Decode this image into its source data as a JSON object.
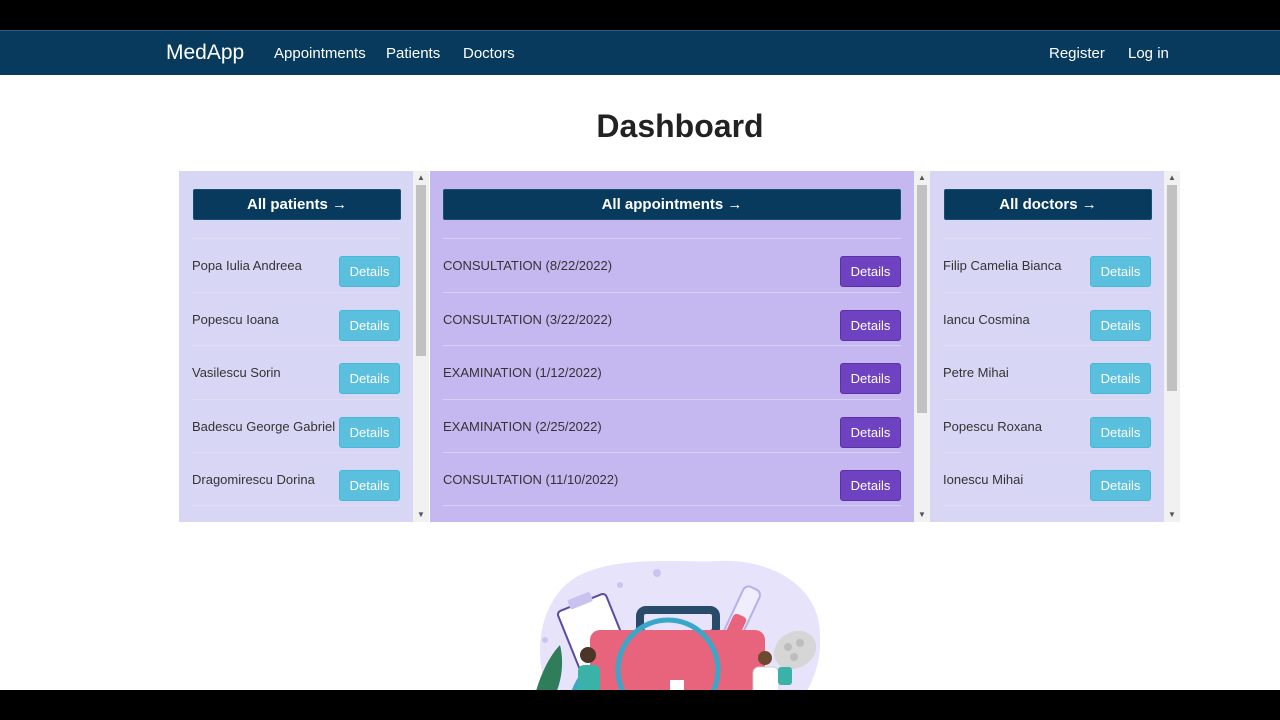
{
  "nav": {
    "brand": "MedApp",
    "links": [
      "Appointments",
      "Patients",
      "Doctors"
    ],
    "right_links": [
      "Register",
      "Log in"
    ]
  },
  "page": {
    "title": "Dashboard"
  },
  "panels": {
    "patients": {
      "header": "All patients →",
      "color": "#d8d6f5",
      "button_color": "#5bc0de",
      "items": [
        {
          "label": "Popa Iulia Andreea",
          "button": "Details"
        },
        {
          "label": "Popescu Ioana",
          "button": "Details"
        },
        {
          "label": "Vasilescu Sorin",
          "button": "Details"
        },
        {
          "label": "Badescu George Gabriel",
          "button": "Details"
        },
        {
          "label": "Dragomirescu Dorina",
          "button": "Details"
        }
      ]
    },
    "appointments": {
      "header": "All appointments →",
      "color": "#c5b8f1",
      "button_color": "#6f42c1",
      "items": [
        {
          "label": "CONSULTATION (8/22/2022)",
          "button": "Details"
        },
        {
          "label": "CONSULTATION (3/22/2022)",
          "button": "Details"
        },
        {
          "label": "EXAMINATION (1/12/2022)",
          "button": "Details"
        },
        {
          "label": "EXAMINATION (2/25/2022)",
          "button": "Details"
        },
        {
          "label": "CONSULTATION (11/10/2022)",
          "button": "Details"
        }
      ]
    },
    "doctors": {
      "header": "All doctors →",
      "color": "#d8d6f5",
      "button_color": "#5bc0de",
      "items": [
        {
          "label": "Filip Camelia Bianca",
          "button": "Details"
        },
        {
          "label": "Iancu Cosmina",
          "button": "Details"
        },
        {
          "label": "Petre Mihai",
          "button": "Details"
        },
        {
          "label": "Popescu Roxana",
          "button": "Details"
        },
        {
          "label": "Ionescu Mihai",
          "button": "Details"
        }
      ]
    }
  },
  "icons": {
    "scroll_up": "scroll-up-arrow-icon",
    "scroll_down": "scroll-down-arrow-icon",
    "illustration": "medical-kit-illustration"
  }
}
